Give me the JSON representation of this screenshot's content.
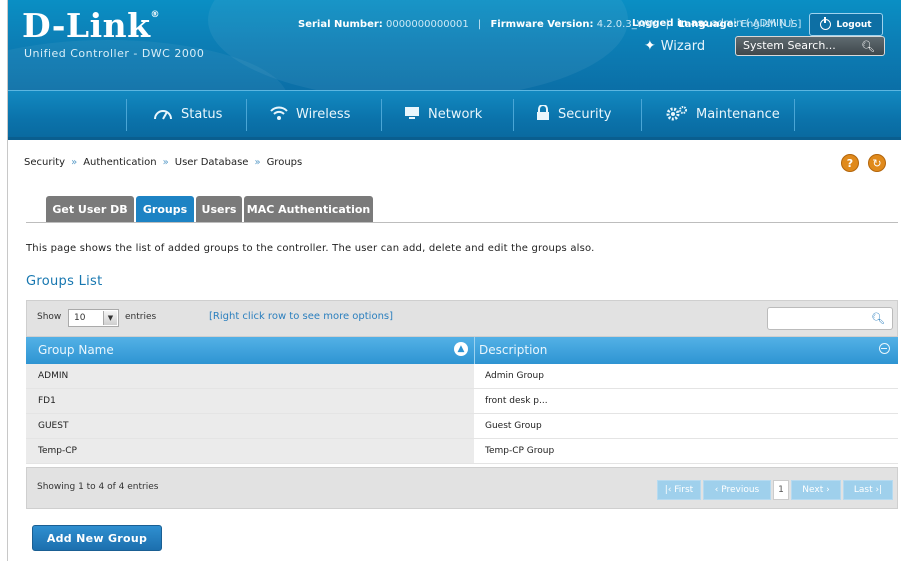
{
  "header": {
    "logo": "D-Link",
    "logo_mark": "®",
    "subtitle": "Unified Controller - DWC 2000",
    "logged_in_label": "Logged in as:",
    "logged_in_value": "admin ( ADMIN )",
    "logout_label": "Logout",
    "serial_label": "Serial Number:",
    "serial_value": "0000000000001",
    "firmware_label": "Firmware Version:",
    "firmware_value": "4.2.0.3_WW",
    "language_label": "Language:",
    "language_value": "English [US]",
    "wizard_label": "Wizard",
    "search_placeholder": "System Search..."
  },
  "nav": {
    "items": [
      {
        "label": "Status",
        "icon": "gauge-icon"
      },
      {
        "label": "Wireless",
        "icon": "wifi-icon"
      },
      {
        "label": "Network",
        "icon": "monitor-icon"
      },
      {
        "label": "Security",
        "icon": "lock-icon"
      },
      {
        "label": "Maintenance",
        "icon": "gears-icon"
      }
    ]
  },
  "breadcrumb": {
    "items": [
      "Security",
      "Authentication",
      "User Database",
      "Groups"
    ],
    "separator": "»"
  },
  "tabs": [
    {
      "label": "Get User DB",
      "active": false
    },
    {
      "label": "Groups",
      "active": true
    },
    {
      "label": "Users",
      "active": false
    },
    {
      "label": "MAC Authentication",
      "active": false
    }
  ],
  "description": "This page shows the list of added groups to the controller. The user can add, delete and edit the groups also.",
  "groups_list": {
    "title": "Groups List",
    "show_label": "Show",
    "entries_value": "10",
    "entries_label": "entries",
    "hint": "[Right click row to see more options]",
    "columns": [
      "Group Name",
      "Description"
    ],
    "rows": [
      {
        "name": "ADMIN",
        "description": "Admin Group"
      },
      {
        "name": "FD1",
        "description": "front desk p..."
      },
      {
        "name": "GUEST",
        "description": "Guest Group"
      },
      {
        "name": "Temp-CP",
        "description": "Temp-CP Group"
      }
    ],
    "info": "Showing 1 to 4 of 4 entries",
    "pager": {
      "first": "|‹ First",
      "previous": "‹ Previous",
      "current": "1",
      "next": "Next ›",
      "last": "Last ›|"
    }
  },
  "add_button": "Add New Group",
  "colors": {
    "accent": "#1d83c4",
    "header": "#0b7fb6",
    "help": "#e08a1c"
  }
}
